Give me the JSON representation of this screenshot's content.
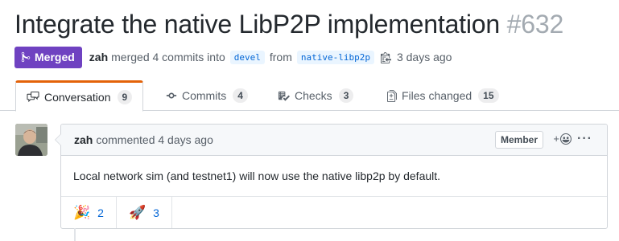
{
  "pr": {
    "title": "Integrate the native LibP2P implementation",
    "number": "#632",
    "status_badge": "Merged",
    "author": "zah",
    "merge_text": "merged 4 commits into",
    "base_branch": "devel",
    "from_text": "from",
    "head_branch": "native-libp2p",
    "time": "3 days ago"
  },
  "tabs": [
    {
      "label": "Conversation",
      "count": "9",
      "icon": "comment-discussion-icon",
      "active": true
    },
    {
      "label": "Commits",
      "count": "4",
      "icon": "git-commit-icon"
    },
    {
      "label": "Checks",
      "count": "3",
      "icon": "checklist-icon"
    },
    {
      "label": "Files changed",
      "count": "15",
      "icon": "file-diff-icon"
    }
  ],
  "comment": {
    "author": "zah",
    "action": "commented 4 days ago",
    "role": "Member",
    "body": "Local network sim (and testnet1) will now use the native libp2p by default.",
    "reactions": [
      {
        "emoji": "🎉",
        "name": "hooray",
        "count": "2"
      },
      {
        "emoji": "🚀",
        "name": "rocket",
        "count": "3"
      }
    ]
  },
  "colors": {
    "merged_badge": "#6f42c1",
    "active_tab_accent": "#e36209",
    "link": "#0366d6",
    "branch_bg": "#eaf5ff"
  }
}
